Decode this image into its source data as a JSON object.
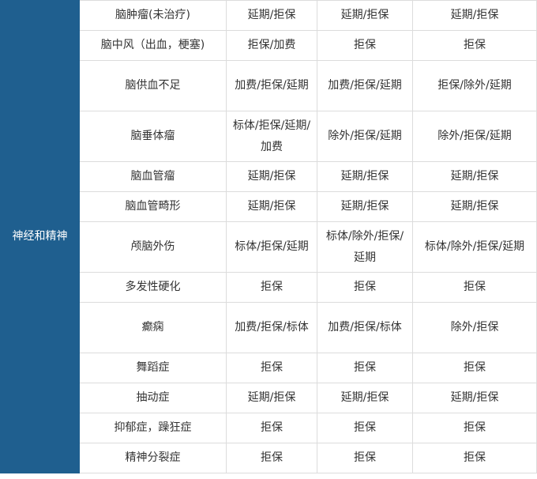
{
  "category": "神经和精神",
  "rows": [
    {
      "name": "脑肿瘤(未治疗)",
      "c1": "延期/拒保",
      "c2": "延期/拒保",
      "c3": "延期/拒保",
      "tall": false
    },
    {
      "name": "脑中风（出血，梗塞)",
      "c1": "拒保/加费",
      "c2": "拒保",
      "c3": "拒保",
      "tall": false
    },
    {
      "name": "脑供血不足",
      "c1": "加费/拒保/延期",
      "c2": "加费/拒保/延期",
      "c3": "拒保/除外/延期",
      "tall": true
    },
    {
      "name": "脑垂体瘤",
      "c1": "标体/拒保/延期/加费",
      "c2": "除外/拒保/延期",
      "c3": "除外/拒保/延期",
      "tall": true
    },
    {
      "name": "脑血管瘤",
      "c1": "延期/拒保",
      "c2": "延期/拒保",
      "c3": "延期/拒保",
      "tall": false
    },
    {
      "name": "脑血管畸形",
      "c1": "延期/拒保",
      "c2": "延期/拒保",
      "c3": "延期/拒保",
      "tall": false
    },
    {
      "name": "颅脑外伤",
      "c1": "标体/拒保/延期",
      "c2": "标体/除外/拒保/延期",
      "c3": "标体/除外/拒保/延期",
      "tall": true
    },
    {
      "name": "多发性硬化",
      "c1": "拒保",
      "c2": "拒保",
      "c3": "拒保",
      "tall": false
    },
    {
      "name": "癫痫",
      "c1": "加费/拒保/标体",
      "c2": "加费/拒保/标体",
      "c3": "除外/拒保",
      "tall": true
    },
    {
      "name": "舞蹈症",
      "c1": "拒保",
      "c2": "拒保",
      "c3": "拒保",
      "tall": false
    },
    {
      "name": "抽动症",
      "c1": "延期/拒保",
      "c2": "延期/拒保",
      "c3": "延期/拒保",
      "tall": false
    },
    {
      "name": "抑郁症，躁狂症",
      "c1": "拒保",
      "c2": "拒保",
      "c3": "拒保",
      "tall": false
    },
    {
      "name": "精神分裂症",
      "c1": "拒保",
      "c2": "拒保",
      "c3": "拒保",
      "tall": false
    }
  ]
}
